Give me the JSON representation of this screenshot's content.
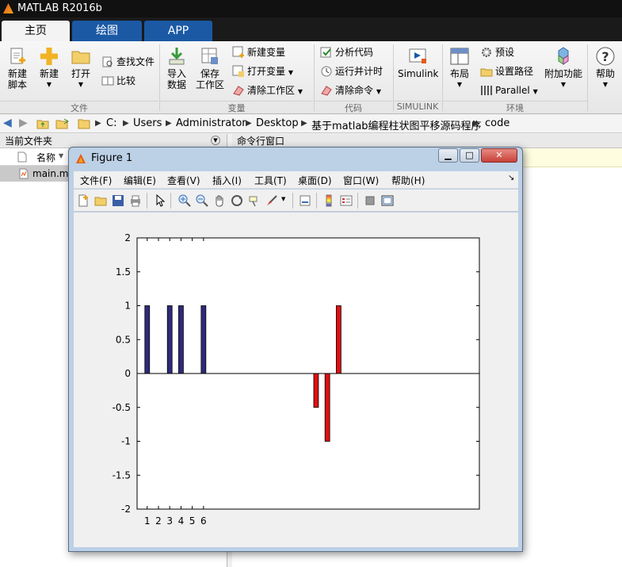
{
  "app": {
    "title": "MATLAB R2016b"
  },
  "tabs": [
    "主页",
    "绘图",
    "APP"
  ],
  "ribbon": {
    "new_script": "新建\n脚本",
    "new": "新建",
    "open": "打开",
    "find_files": "查找文件",
    "compare": "比较",
    "import_data": "导入\n数据",
    "save_workspace": "保存\n工作区",
    "new_variable": "新建变量",
    "open_variable": "打开变量",
    "clear_workspace": "清除工作区",
    "analyze_code": "分析代码",
    "run_and_time": "运行并计时",
    "clear_commands": "清除命令",
    "simulink": "Simulink",
    "layout": "布局",
    "preferences": "预设",
    "set_path": "设置路径",
    "parallel": "Parallel",
    "add_ons": "附加功能",
    "help": "帮助",
    "sections": [
      "文件",
      "变量",
      "代码",
      "SIMULINK",
      "环境"
    ]
  },
  "address": {
    "parts": [
      "C:",
      "Users",
      "Administrator",
      "Desktop",
      "基于matlab编程柱状图平移源码程序",
      "code"
    ]
  },
  "left_panel": {
    "title": "当前文件夹",
    "column": "名称",
    "files": [
      "main.m"
    ]
  },
  "command_panel": {
    "title": "命令行窗口"
  },
  "figure": {
    "title": "Figure 1",
    "menu": [
      "文件(F)",
      "编辑(E)",
      "查看(V)",
      "插入(I)",
      "工具(T)",
      "桌面(D)",
      "窗口(W)",
      "帮助(H)"
    ]
  },
  "chart_data": {
    "type": "bar",
    "x": [
      1,
      2,
      3,
      4,
      5,
      6,
      16,
      17,
      18
    ],
    "xtick_labels": [
      "1",
      "2",
      "3",
      "4",
      "5",
      "6"
    ],
    "xticks": [
      1,
      2,
      3,
      4,
      5,
      6
    ],
    "series": [
      {
        "values": [
          1,
          0,
          1,
          1,
          0,
          1,
          0,
          0,
          0
        ],
        "color": "#2e2a7a"
      },
      {
        "values": [
          0,
          0,
          0,
          0,
          0,
          0,
          -0.5,
          -1,
          1
        ],
        "color": "#e01010"
      }
    ],
    "xlim": [
      0.1,
      30.5
    ],
    "ylim": [
      -2,
      2
    ],
    "yticks": [
      -2,
      -1.5,
      -1,
      -0.5,
      0,
      0.5,
      1,
      1.5,
      2
    ],
    "ytick_labels": [
      "-2",
      "-1.5",
      "-1",
      "-0.5",
      "0",
      "0.5",
      "1",
      "1.5",
      "2"
    ],
    "grid": false
  },
  "colors": {
    "accent": "#1b59a5",
    "figure_frame": "#bcd0e6",
    "close": "#c8413a"
  }
}
